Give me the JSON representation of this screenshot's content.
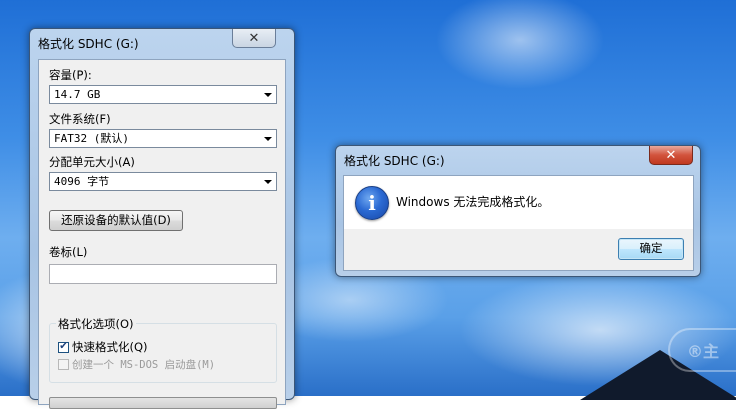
{
  "format_dialog": {
    "title": "格式化 SDHC (G:)",
    "capacity_label": "容量(P):",
    "capacity_value": "14.7 GB",
    "filesystem_label": "文件系统(F)",
    "filesystem_value": "FAT32 (默认)",
    "allocation_label": "分配单元大小(A)",
    "allocation_value": "4096 字节",
    "restore_defaults_button": "还原设备的默认值(D)",
    "volume_label_label": "卷标(L)",
    "volume_label_value": "",
    "options_group_label": "格式化选项(O)",
    "quick_format_label": "快速格式化(Q)",
    "quick_format_checked": true,
    "msdos_startup_label": "创建一个 MS-DOS 启动盘(M)",
    "msdos_startup_checked": false,
    "progress": 0
  },
  "message_box": {
    "title": "格式化 SDHC (G:)",
    "message": "Windows 无法完成格式化。",
    "ok_button": "确定",
    "icon": "info-icon"
  },
  "colors": {
    "close_red": "#c0391f",
    "ok_border": "#3c7fb1",
    "desktop_sky": "#3f8ee6"
  }
}
